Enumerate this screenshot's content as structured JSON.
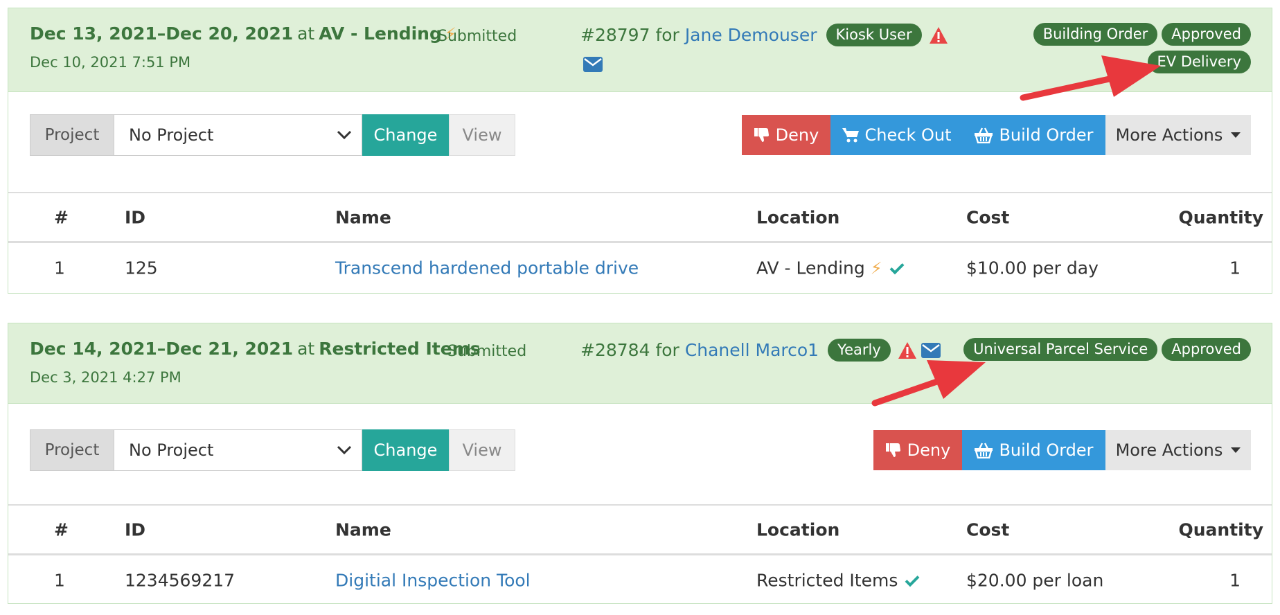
{
  "orders": [
    {
      "date_range": "Dec 13, 2021–Dec 20, 2021",
      "at": "at",
      "location": "AV - Lending",
      "status": "Submitted",
      "created": "Dec 10, 2021 7:51 PM",
      "order_number": "#28797",
      "for": "for",
      "patron": "Jane Demouser",
      "patron_badge": "Kiosk User",
      "right_badges": [
        "Building Order",
        "Approved"
      ],
      "right_badge_2": "EV Delivery",
      "project_label": "Project",
      "project_value": "No Project",
      "change_label": "Change",
      "view_label": "View",
      "actions": {
        "deny": "Deny",
        "check_out": "Check Out",
        "build_order": "Build Order",
        "more_actions": "More Actions"
      },
      "columns": [
        "#",
        "ID",
        "Name",
        "Location",
        "Cost",
        "Quantity"
      ],
      "rows": [
        {
          "num": "1",
          "id": "125",
          "name": "Transcend hardened portable drive",
          "location": "AV - Lending",
          "cost": "$10.00 per day",
          "qty": "1"
        }
      ]
    },
    {
      "date_range": "Dec 14, 2021–Dec 21, 2021",
      "at": "at",
      "location": "Restricted Items",
      "status": "Submitted",
      "created": "Dec 3, 2021 4:27 PM",
      "order_number": "#28784",
      "for": "for",
      "patron": "Chanell Marco1",
      "patron_badge": "Yearly",
      "right_badges": [
        "Universal Parcel Service",
        "Approved"
      ],
      "project_label": "Project",
      "project_value": "No Project",
      "change_label": "Change",
      "view_label": "View",
      "actions": {
        "deny": "Deny",
        "build_order": "Build Order",
        "more_actions": "More Actions"
      },
      "columns": [
        "#",
        "ID",
        "Name",
        "Location",
        "Cost",
        "Quantity"
      ],
      "rows": [
        {
          "num": "1",
          "id": "1234569217",
          "name": "Digitial Inspection Tool",
          "location": "Restricted Items",
          "cost": "$20.00 per loan",
          "qty": "1"
        }
      ]
    }
  ],
  "colors": {
    "header_bg": "#dff0d8",
    "green_text": "#3c763d",
    "badge": "#3c763d",
    "link": "#337ab7",
    "deny": "#d9534f",
    "primary": "#3498db",
    "change": "#26a69a",
    "warning": "#e84545",
    "arrow": "#e8383d"
  },
  "icons": [
    "lightning-icon",
    "warning-icon",
    "envelope-icon",
    "chevron-down-icon",
    "thumbs-down-icon",
    "cart-icon",
    "basket-icon",
    "caret-down-icon",
    "check-icon",
    "arrow-annotation"
  ]
}
